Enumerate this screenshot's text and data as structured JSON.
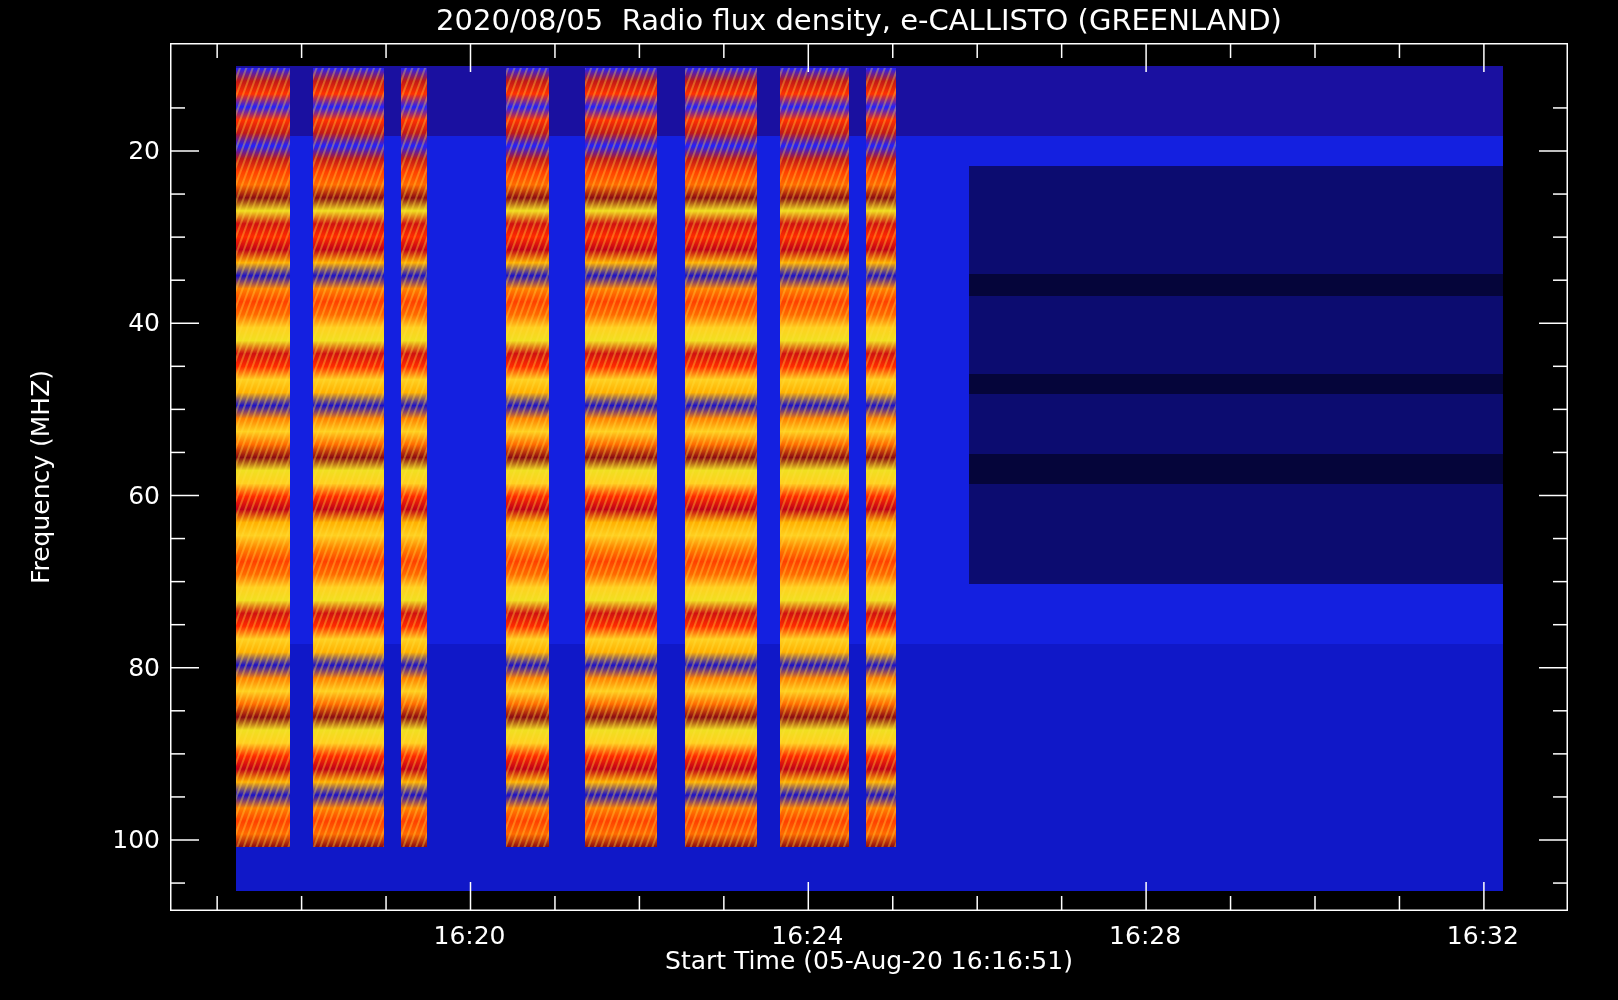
{
  "title": "2020/08/05  Radio flux density, e-CALLISTO (GREENLAND)",
  "y_axis": {
    "label": "Frequency (MHZ)",
    "ticks": [
      "20",
      "40",
      "60",
      "80",
      "100"
    ]
  },
  "x_axis": {
    "label": "Start Time (05-Aug-20 16:16:51)",
    "ticks": [
      "16:20",
      "16:24",
      "16:28",
      "16:32"
    ]
  }
}
